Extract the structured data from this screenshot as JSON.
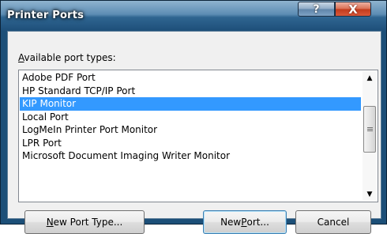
{
  "window": {
    "title": "Printer Ports",
    "help_label": "?",
    "close_label": "X"
  },
  "list": {
    "label_accel": "A",
    "label_rest": "vailable port types:",
    "items": [
      "Adobe PDF Port",
      "HP Standard TCP/IP Port",
      "KIP Monitor",
      "Local Port",
      "LogMeIn Printer Port Monitor",
      "LPR Port",
      "Microsoft Document Imaging Writer Monitor"
    ],
    "selected_index": 2
  },
  "buttons": {
    "new_port_type": {
      "accel": "N",
      "rest": "ew Port Type..."
    },
    "new_port": {
      "pre": "New ",
      "accel": "P",
      "rest": "ort..."
    },
    "cancel": "Cancel"
  },
  "icons": {
    "scroll_up": "▲",
    "scroll_down": "▼"
  }
}
